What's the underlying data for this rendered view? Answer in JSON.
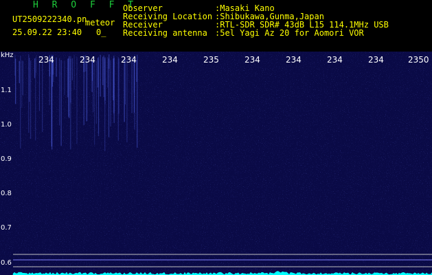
{
  "header": {
    "program": "H R O F F T",
    "filename": "UT2509222340.pn",
    "tag": "meteor",
    "datetime": "25.09.22 23:40",
    "frame": "0_",
    "info": [
      {
        "key": "Observer",
        "value": ":Masaki Kano"
      },
      {
        "key": "Receiving Location",
        "value": ":Shibukawa,Gunma,Japan"
      },
      {
        "key": "Receiver",
        "value": ":RTL-SDR SDR# 43dB L15 114.1MHz USB"
      },
      {
        "key": "Receiving antenna",
        "value": ":5el Yagi Az 20 for Aomori VOR"
      }
    ]
  },
  "axes": {
    "unit": "kHz",
    "y_ticks": [
      "1.1",
      "1.0",
      "0.9",
      "0.8",
      "0.7",
      "0.6"
    ],
    "x_ticks": [
      "234",
      "234",
      "234",
      "234",
      "235",
      "234",
      "234",
      "234",
      "234",
      "2350"
    ]
  },
  "colors": {
    "background": "#000000",
    "waterfall": "#0a0a46",
    "signal": "#00ffff",
    "text_header": "#ffff00",
    "text_green": "#1ecf3c"
  }
}
